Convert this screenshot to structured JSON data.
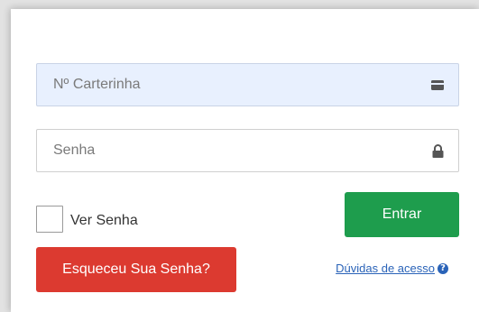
{
  "login": {
    "card_number_placeholder": "Nº Carterinha",
    "card_number_value": "",
    "password_placeholder": "Senha",
    "password_value": "",
    "show_password_label": "Ver Senha",
    "show_password_checked": false,
    "enter_label": "Entrar",
    "forgot_label": "Esqueceu Sua Senha?",
    "help_link_label": "Dúvidas de acesso",
    "help_icon_glyph": "?"
  },
  "icons": {
    "card_field": "id-card-icon",
    "password_field": "lock-icon",
    "help": "question-circle-icon"
  },
  "colors": {
    "card_field_bg": "#e8f0fe",
    "enter_button": "#1e9d4d",
    "forgot_button": "#dc3a30",
    "link": "#2a63b8"
  }
}
